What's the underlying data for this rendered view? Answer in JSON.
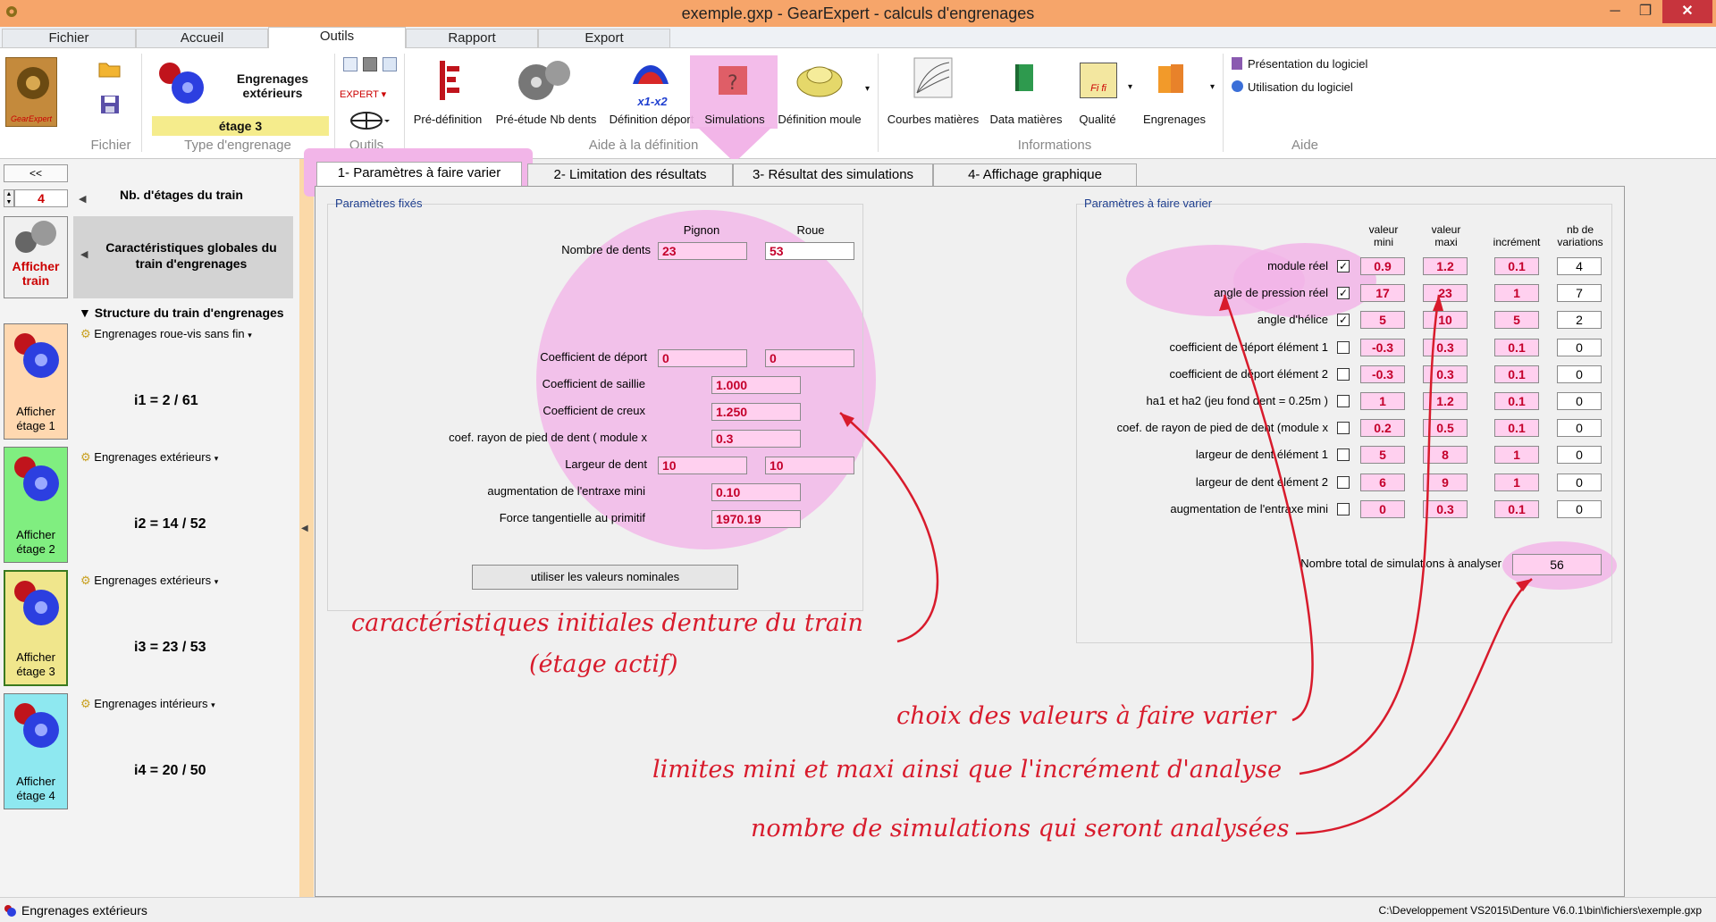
{
  "window": {
    "title": "exemple.gxp - GearExpert - calculs d'engrenages",
    "minimize_glyph": "─",
    "maximize_glyph": "❐",
    "close_glyph": "✕"
  },
  "ribbon_tabs": [
    "Fichier",
    "Accueil",
    "Outils",
    "Rapport",
    "Export"
  ],
  "ribbon": {
    "logo_text": "GearExpert",
    "type_title": "Engrenages extérieurs",
    "stage_badge": "étage 3",
    "expert_label": "EXPERT",
    "buttons": {
      "predefinition": "Pré-définition",
      "preetude": "Pré-étude Nb dents",
      "definition_deport": "Définition déport",
      "simulations": "Simulations",
      "definition_moule": "Définition moule",
      "courbes": "Courbes matières",
      "data": "Data matières",
      "qualite": "Qualité",
      "engrenages": "Engrenages",
      "presentation": "Présentation du logiciel",
      "utilisation": "Utilisation du logiciel",
      "deport_icon_text": "x1-x2",
      "qualite_icon_text": "Fi fi"
    },
    "groups": [
      "Fichier",
      "Type d'engrenage",
      "Outils",
      "Aide à la définition",
      "Informations",
      "Aide"
    ]
  },
  "left": {
    "collapse": "<<",
    "stages_count": "4",
    "stages_label": "Nb. d'étages du train",
    "global_label": "Caractéristiques globales du train d'engrenages",
    "show_train": "Afficher train",
    "structure_label": "Structure du train d'engrenages",
    "stages": [
      {
        "type": "Engrenages roue-vis sans fin",
        "ratio": "i1 = 2 / 61",
        "btn": "Afficher étage 1",
        "color": "#ffd8b0"
      },
      {
        "type": "Engrenages extérieurs",
        "ratio": "i2 = 14 / 52",
        "btn": "Afficher étage 2",
        "color": "#80ee80"
      },
      {
        "type": "Engrenages extérieurs",
        "ratio": "i3 = 23 / 53",
        "btn": "Afficher étage 3",
        "color": "#f0e68c"
      },
      {
        "type": "Engrenages intérieurs",
        "ratio": "i4 = 20 / 50",
        "btn": "Afficher étage 4",
        "color": "#8ee8f0"
      }
    ]
  },
  "tabs": [
    "1- Paramètres à faire varier",
    "2- Limitation des résultats",
    "3- Résultat des simulations",
    "4- Affichage graphique"
  ],
  "fixed": {
    "title": "Paramètres fixés",
    "col_pignon": "Pignon",
    "col_roue": "Roue",
    "nb_dents_label": "Nombre de dents",
    "nb_dents_pignon": "23",
    "nb_dents_roue": "53",
    "deport_label": "Coefficient de déport",
    "deport_pignon": "0",
    "deport_roue": "0",
    "saillie_label": "Coefficient de saillie",
    "saillie": "1.000",
    "creux_label": "Coefficient de creux",
    "creux": "1.250",
    "rayon_label": "coef. rayon de pied de dent ( module x",
    "rayon": "0.3",
    "largeur_label": "Largeur de dent",
    "largeur_pignon": "10",
    "largeur_roue": "10",
    "entraxe_label": "augmentation de l'entraxe mini",
    "entraxe": "0.10",
    "force_label": "Force tangentielle au primitif",
    "force": "1970.19",
    "nominal_btn": "utiliser les valeurs nominales"
  },
  "vary": {
    "title": "Paramètres à faire varier",
    "headers": [
      "valeur mini",
      "valeur maxi",
      "incrément",
      "nb de variations"
    ],
    "rows": [
      {
        "label": "module réel",
        "checked": true,
        "min": "0.9",
        "max": "1.2",
        "inc": "0.1",
        "n": "4"
      },
      {
        "label": "angle de pression réel",
        "checked": true,
        "min": "17",
        "max": "23",
        "inc": "1",
        "n": "7"
      },
      {
        "label": "angle d'hélice",
        "checked": true,
        "min": "5",
        "max": "10",
        "inc": "5",
        "n": "2"
      },
      {
        "label": "coefficient de déport élément 1",
        "checked": false,
        "min": "-0.3",
        "max": "0.3",
        "inc": "0.1",
        "n": "0"
      },
      {
        "label": "coefficient de déport élément 2",
        "checked": false,
        "min": "-0.3",
        "max": "0.3",
        "inc": "0.1",
        "n": "0"
      },
      {
        "label": "ha1 et ha2 (jeu fond dent = 0.25m )",
        "checked": false,
        "min": "1",
        "max": "1.2",
        "inc": "0.1",
        "n": "0"
      },
      {
        "label": "coef. de rayon de pied de dent (module x",
        "checked": false,
        "min": "0.2",
        "max": "0.5",
        "inc": "0.1",
        "n": "0"
      },
      {
        "label": "largeur de dent élément 1",
        "checked": false,
        "min": "5",
        "max": "8",
        "inc": "1",
        "n": "0"
      },
      {
        "label": "largeur de dent élément 2",
        "checked": false,
        "min": "6",
        "max": "9",
        "inc": "1",
        "n": "0"
      },
      {
        "label": "augmentation de l'entraxe mini",
        "checked": false,
        "min": "0",
        "max": "0.3",
        "inc": "0.1",
        "n": "0"
      }
    ],
    "total_label": "Nombre total de simulations à analyser",
    "total": "56"
  },
  "annotations": {
    "a1_line1": "caractéristiques initiales denture du train",
    "a1_line2": "(étage actif)",
    "a2": "choix des valeurs à faire varier",
    "a3": "limites mini et maxi ainsi que l'incrément d'analyse",
    "a4": "nombre de simulations qui seront analysées"
  },
  "status": {
    "left": "Engrenages extérieurs",
    "right": "C:\\Developpement VS2015\\Denture V6.0.1\\bin\\fichiers\\exemple.gxp"
  },
  "colors": {
    "pink_field": "#ffd0ef",
    "highlight": "#f2b5e8",
    "annot_red": "#d81b2c",
    "titlebar": "#f6a56a"
  }
}
